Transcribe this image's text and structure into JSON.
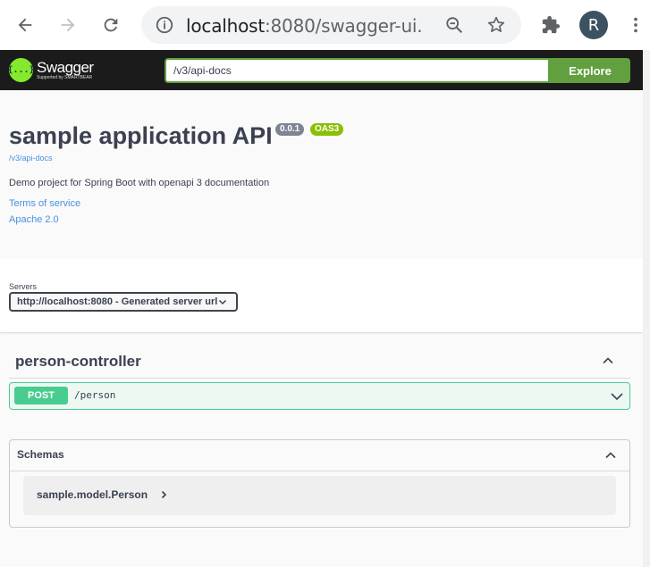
{
  "browser": {
    "url_host": "localhost",
    "url_rest": ":8080/swagger-ui...",
    "avatar_letter": "R"
  },
  "topbar": {
    "logo_title": "Swagger",
    "logo_sub": "Supported by SMARTBEAR",
    "logo_glyph": "{...}",
    "url_value": "/v3/api-docs",
    "explore_label": "Explore"
  },
  "info": {
    "title": "sample application API",
    "version": "0.0.1",
    "oas": "OAS3",
    "spec_link": "/v3/api-docs",
    "description": "Demo project for Spring Boot with openapi 3 documentation",
    "terms": "Terms of service",
    "license": "Apache 2.0"
  },
  "servers": {
    "label": "Servers",
    "selected": "http://localhost:8080 - Generated server url"
  },
  "tag": {
    "name": "person-controller"
  },
  "operation": {
    "method": "POST",
    "path": "/person"
  },
  "schemas": {
    "title": "Schemas",
    "models": [
      "sample.model.Person"
    ]
  },
  "colors": {
    "accent_green": "#62a03f",
    "post_green": "#49cc90",
    "link_blue": "#4990e2",
    "text_dark": "#3b4151"
  }
}
